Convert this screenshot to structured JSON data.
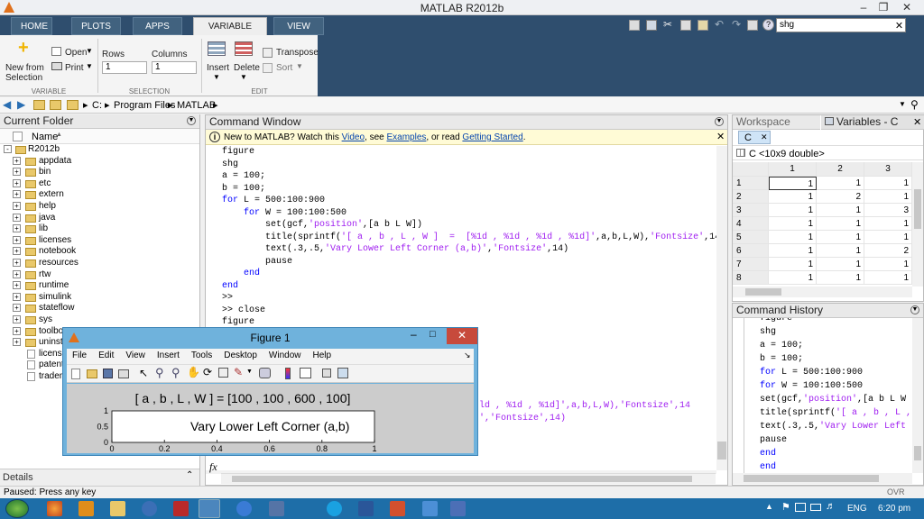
{
  "app": {
    "title": "MATLAB R2012b"
  },
  "tabs": [
    "HOME",
    "PLOTS",
    "APPS",
    "VARIABLE",
    "VIEW"
  ],
  "search": {
    "value": "shg"
  },
  "ribbon": {
    "new_from_selection": "New from\nSelection",
    "open": "Open",
    "print": "Print",
    "rows_label": "Rows",
    "rows_value": "1",
    "cols_label": "Columns",
    "cols_value": "1",
    "insert": "Insert",
    "delete": "Delete",
    "transpose": "Transpose",
    "sort": "Sort",
    "sections": [
      "VARIABLE",
      "SELECTION",
      "EDIT"
    ]
  },
  "address": {
    "parts": [
      "C:",
      "Program Files",
      "MATLAB"
    ]
  },
  "current_folder": {
    "title": "Current Folder",
    "column": "Name",
    "root": "R2012b",
    "items": [
      "appdata",
      "bin",
      "etc",
      "extern",
      "help",
      "java",
      "lib",
      "licenses",
      "notebook",
      "resources",
      "rtw",
      "runtime",
      "simulink",
      "stateflow",
      "sys",
      "toolbox",
      "uninstall"
    ],
    "files": [
      "license",
      "patents",
      "tradem"
    ],
    "details": "Details"
  },
  "command_window": {
    "title": "Command Window",
    "notice_prefix": "New to MATLAB? Watch this ",
    "notice_link1": "Video",
    "notice_mid": ", see ",
    "notice_link2": "Examples",
    "notice_mid2": ", or read ",
    "notice_link3": "Getting Started",
    "notice_suffix": ".",
    "prompt_fx": "fx",
    "lines": [
      [
        {
          "t": "figure"
        }
      ],
      [
        {
          "t": "shg"
        }
      ],
      [
        {
          "t": "a = 100;"
        }
      ],
      [
        {
          "t": "b = 100;"
        }
      ],
      [
        {
          "t": "for ",
          "k": 1
        },
        {
          "t": "L = 500:100:900"
        }
      ],
      [
        {
          "t": "    for ",
          "k": 1
        },
        {
          "t": "W = 100:100:500"
        }
      ],
      [
        {
          "t": "        set(gcf,"
        },
        {
          "t": "'position'",
          "s": 1
        },
        {
          "t": ",[a b L W])"
        }
      ],
      [
        {
          "t": "        title(sprintf("
        },
        {
          "t": "'[ a , b , L , W ]  =  [%1d , %1d , %1d , %1d]'",
          "s": 1
        },
        {
          "t": ",a,b,L,W),"
        },
        {
          "t": "'Fontsize'",
          "s": 1
        },
        {
          "t": ",14"
        }
      ],
      [
        {
          "t": "        text(.3,.5,"
        },
        {
          "t": "'Vary Lower Left Corner (a,b)'",
          "s": 1
        },
        {
          "t": ","
        },
        {
          "t": "'Fontsize'",
          "s": 1
        },
        {
          "t": ",14)"
        }
      ],
      [
        {
          "t": "        pause"
        }
      ],
      [
        {
          "t": "    end",
          "k": 1
        }
      ],
      [
        {
          "t": "end",
          "k": 1
        }
      ],
      [
        {
          "t": ">>"
        }
      ],
      [
        {
          "t": ">> close"
        }
      ],
      [
        {
          "t": "figure"
        }
      ]
    ],
    "hidden_tail1": "ld , %1d , %1d]',a,b,L,W),'Fontsize',14",
    "hidden_tail2": "','Fontsize',14)"
  },
  "workspace": {
    "title": "Workspace"
  },
  "variables": {
    "title": "Variables - C",
    "tab": "C",
    "info": "C <10x9 double>",
    "col_headers": [
      "1",
      "2",
      "3"
    ],
    "row_headers": [
      "1",
      "2",
      "3",
      "4",
      "5",
      "6",
      "7",
      "8"
    ],
    "cells": [
      [
        "1",
        "1",
        "1"
      ],
      [
        "1",
        "2",
        "1"
      ],
      [
        "1",
        "1",
        "3"
      ],
      [
        "1",
        "1",
        "1"
      ],
      [
        "1",
        "1",
        "1"
      ],
      [
        "1",
        "1",
        "2"
      ],
      [
        "1",
        "1",
        "1"
      ],
      [
        "1",
        "1",
        "1"
      ]
    ]
  },
  "history": {
    "title": "Command History",
    "lines": [
      [
        {
          "t": "figure"
        }
      ],
      [
        {
          "t": "shg"
        }
      ],
      [
        {
          "t": "a = 100;"
        }
      ],
      [
        {
          "t": "b = 100;"
        }
      ],
      [
        {
          "t": "for ",
          "k": 1
        },
        {
          "t": "L = 500:100:900"
        }
      ],
      [
        {
          "t": "for ",
          "k": 1
        },
        {
          "t": "W = 100:100:500"
        }
      ],
      [
        {
          "t": "set(gcf,"
        },
        {
          "t": "'position'",
          "s": 1
        },
        {
          "t": ",[a b L W"
        }
      ],
      [
        {
          "t": "title(sprintf("
        },
        {
          "t": "'[ a , b , L ,",
          "s": 1
        }
      ],
      [
        {
          "t": "text(.3,.5,"
        },
        {
          "t": "'Vary Lower Left",
          "s": 1
        }
      ],
      [
        {
          "t": "pause"
        }
      ],
      [
        {
          "t": "end",
          "k": 1
        }
      ],
      [
        {
          "t": "end",
          "k": 1
        }
      ]
    ]
  },
  "figure": {
    "title": "Figure 1",
    "menu": [
      "File",
      "Edit",
      "View",
      "Insert",
      "Tools",
      "Desktop",
      "Window",
      "Help"
    ],
    "plot_title": "[ a , b , L , W ] = [100 , 100 , 600 , 100]",
    "text": "Vary Lower Left Corner (a,b)",
    "yticks": [
      "1",
      "0.5",
      "0"
    ],
    "xticks": [
      "0",
      "0.2",
      "0.4",
      "0.6",
      "0.8",
      "1"
    ]
  },
  "status": {
    "text": "Paused: Press any key",
    "ovr": "OVR"
  },
  "taskbar": {
    "lang": "ENG",
    "time": "6:20 pm"
  },
  "colors": {
    "accent": "#2f4e6e",
    "taskbar": "#1e6ea8",
    "keyword": "#0000ff",
    "string": "#a020f0"
  }
}
